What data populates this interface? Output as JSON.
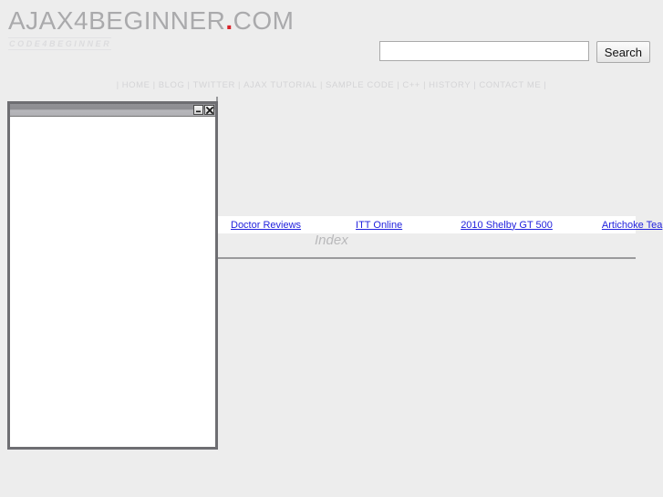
{
  "header": {
    "logo_main": "AJAX4BEGINNER",
    "logo_dot": ".",
    "logo_tld": "COM",
    "tagline": "CODE4BEGINNER",
    "accent_color": "#d8232a",
    "logo_color": "#aaaaac"
  },
  "search": {
    "value": "",
    "placeholder": "",
    "button_label": "Search"
  },
  "nav": {
    "leading_separator": "|",
    "trailing_separator": "|",
    "items": [
      {
        "label": "HOME"
      },
      {
        "label": "BLOG"
      },
      {
        "label": "TWITTER"
      },
      {
        "label": "AJAX TUTORIAL"
      },
      {
        "label": "SAMPLE CODE"
      },
      {
        "label": "C++"
      },
      {
        "label": "HISTORY"
      },
      {
        "label": "CONTACT ME"
      }
    ],
    "separator": "|"
  },
  "main": {
    "links": [
      {
        "label": "Doctor Reviews"
      },
      {
        "label": "ITT Online"
      },
      {
        "label": "2010 Shelby GT 500"
      },
      {
        "label": "Artichoke Tea"
      }
    ],
    "link_color": "#2222dd",
    "index_label": "Index"
  },
  "popup": {
    "title": "",
    "minimize_label": "minimize",
    "close_label": "close",
    "content": ""
  }
}
